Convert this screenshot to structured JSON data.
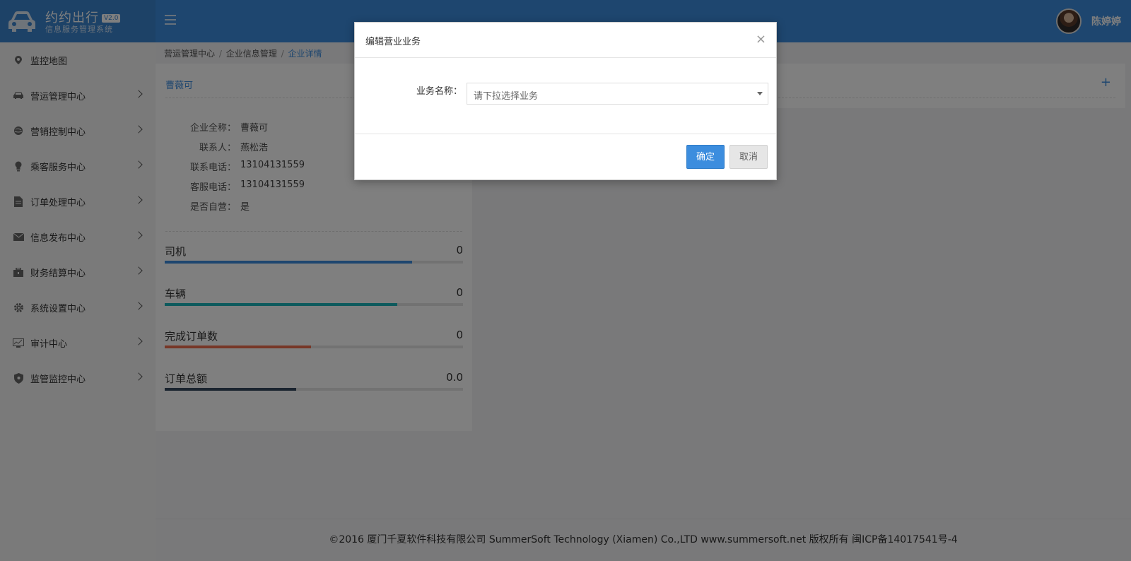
{
  "header": {
    "app_name": "约约出行",
    "version": "V2.0",
    "subtitle": "信息服务管理系统",
    "user_name": "陈婷婷"
  },
  "sidebar": {
    "items": [
      {
        "label": "监控地图",
        "icon": "map-pin-icon",
        "has_children": false
      },
      {
        "label": "营运管理中心",
        "icon": "car-icon",
        "has_children": true
      },
      {
        "label": "营销控制中心",
        "icon": "globe-icon",
        "has_children": true
      },
      {
        "label": "乘客服务中心",
        "icon": "bulb-icon",
        "has_children": true
      },
      {
        "label": "订单处理中心",
        "icon": "document-icon",
        "has_children": true
      },
      {
        "label": "信息发布中心",
        "icon": "envelope-icon",
        "has_children": true
      },
      {
        "label": "财务结算中心",
        "icon": "briefcase-icon",
        "has_children": true
      },
      {
        "label": "系统设置中心",
        "icon": "gear-icon",
        "has_children": true
      },
      {
        "label": "审计中心",
        "icon": "monitor-chart-icon",
        "has_children": true
      },
      {
        "label": "监管监控中心",
        "icon": "shield-icon",
        "has_children": true
      }
    ]
  },
  "breadcrumb": {
    "items": [
      "营运管理中心",
      "企业信息管理",
      "企业详情"
    ],
    "separator": "/"
  },
  "company": {
    "title": "曹薇可",
    "info": [
      {
        "label": "企业全称：",
        "value": "曹薇可"
      },
      {
        "label": "联系人：",
        "value": "燕松浩"
      },
      {
        "label": "联系电话：",
        "value": "13104131559"
      },
      {
        "label": "客服电话：",
        "value": "13104131559"
      },
      {
        "label": "是否自营：",
        "value": "是"
      }
    ],
    "stats": [
      {
        "label": "司机",
        "value": "0",
        "progress": 0.83,
        "color": "#3c8dde"
      },
      {
        "label": "车辆",
        "value": "0",
        "progress": 0.78,
        "color": "#1bb5ba"
      },
      {
        "label": "完成订单数",
        "value": "0",
        "progress": 0.49,
        "color": "#ee6f4f"
      },
      {
        "label": "订单总额",
        "value": "0.0",
        "progress": 0.44,
        "color": "#34495e"
      }
    ]
  },
  "right_panel": {
    "add_label": "+"
  },
  "modal": {
    "title": "编辑营业业务",
    "close_label": "×",
    "field_label": "业务名称：",
    "select_placeholder": "请下拉选择业务",
    "confirm_label": "确定",
    "cancel_label": "取消"
  },
  "footer": {
    "text": "©2016 厦门千夏软件科技有限公司 SummerSoft Technology (Xiamen) Co.,LTD www.summersoft.net 版权所有 闽ICP备14017541号-4"
  }
}
